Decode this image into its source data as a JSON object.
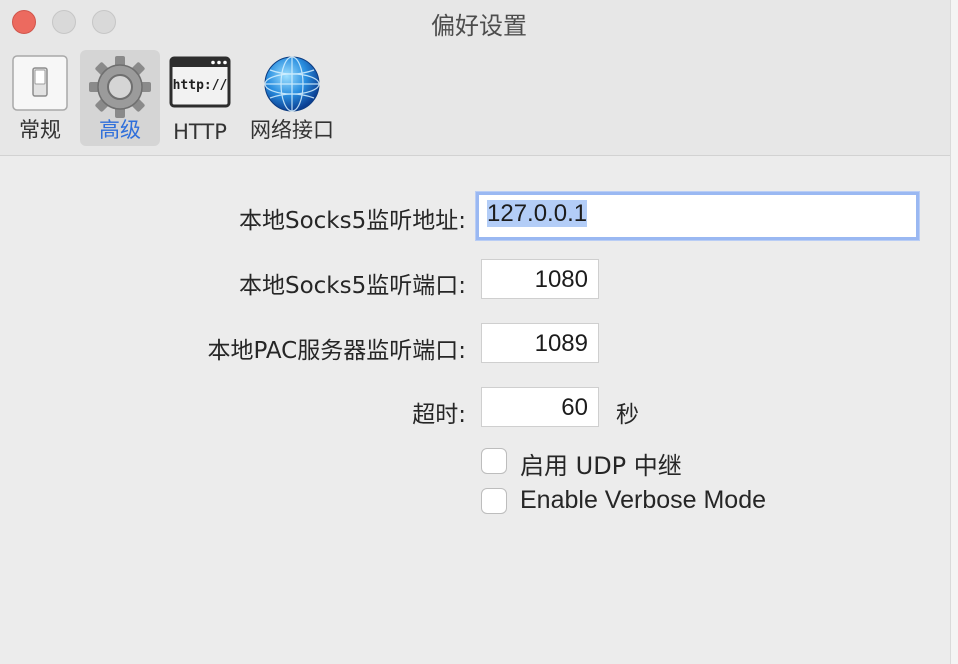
{
  "window": {
    "title": "偏好设置",
    "controls": [
      "close",
      "minimize",
      "zoom"
    ]
  },
  "toolbar": {
    "tabs": [
      {
        "label": "常规",
        "icon": "switch-icon",
        "selected": false
      },
      {
        "label": "高级",
        "icon": "gear-icon",
        "selected": true
      },
      {
        "label": "HTTP",
        "icon": "http-window-icon",
        "selected": false
      },
      {
        "label": "网络接口",
        "icon": "globe-icon",
        "selected": false
      }
    ]
  },
  "form": {
    "socks5_address": {
      "label": "本地Socks5监听地址:",
      "value": "127.0.0.1"
    },
    "socks5_port": {
      "label": "本地Socks5监听端口:",
      "value": "1080"
    },
    "pac_port": {
      "label": "本地PAC服务器监听端口:",
      "value": "1089"
    },
    "timeout": {
      "label": "超时:",
      "value": "60",
      "unit": "秒"
    },
    "udp_relay": {
      "label": "启用 UDP 中继",
      "checked": false
    },
    "verbose_mode": {
      "label": "Enable Verbose Mode",
      "checked": false
    }
  },
  "colors": {
    "accent": "#2f6fdb",
    "close": "#ec6a5f",
    "focus_ring": "#9ab8f2",
    "selection": "#b3cdf7"
  }
}
